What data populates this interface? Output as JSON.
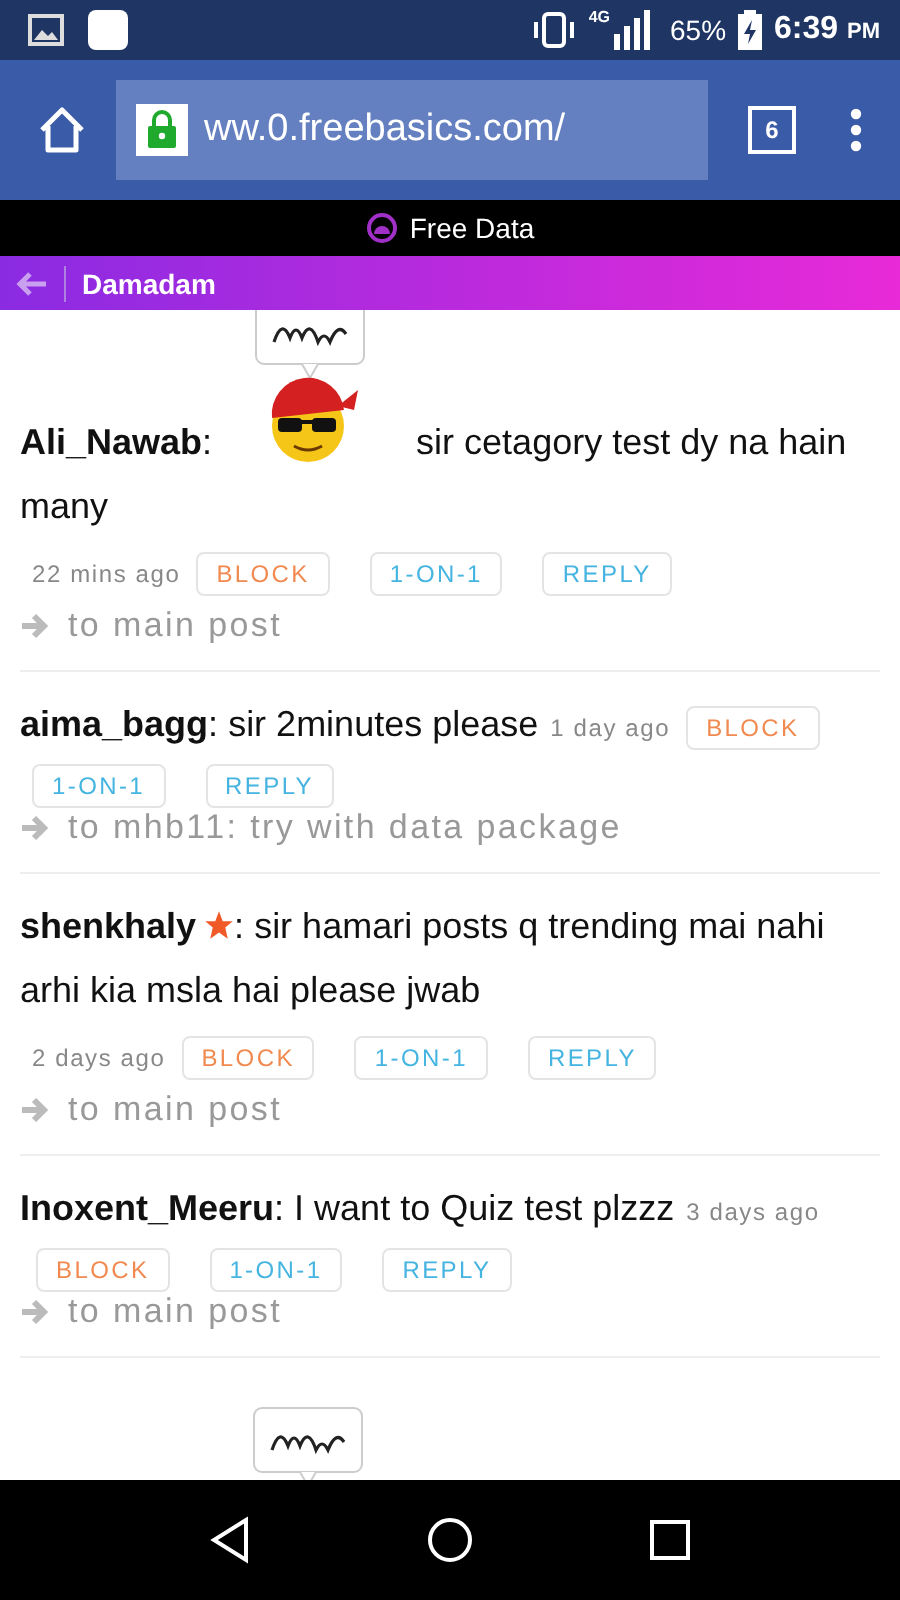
{
  "status_bar": {
    "network": "4G",
    "battery": "65%",
    "time": "6:39",
    "ampm": "PM"
  },
  "browser": {
    "url": "ww.0.freebasics.com/",
    "tabs_count": "6"
  },
  "free_data_bar": {
    "label": "Free Data"
  },
  "header": {
    "title": "Damadam"
  },
  "posts": [
    {
      "author": "Ali_Nawab",
      "separator": ":",
      "starred": false,
      "sticker": true,
      "message": "sir cetagory test dy na hain many",
      "time": "22 mins ago",
      "buttons": [
        "BLOCK",
        "1-ON-1",
        "REPLY"
      ],
      "link": "to main post"
    },
    {
      "author": "aima_bagg",
      "separator": ":",
      "starred": false,
      "sticker": false,
      "message": "sir 2minutes please",
      "time": "1 day ago",
      "buttons": [
        "BLOCK",
        "1-ON-1",
        "REPLY"
      ],
      "link": "to mhb11: try with data package"
    },
    {
      "author": "shenkhaly",
      "separator": ":",
      "starred": true,
      "sticker": false,
      "message": "sir hamari posts q trending mai nahi arhi kia msla hai please jwab",
      "time": "2 days ago",
      "buttons": [
        "BLOCK",
        "1-ON-1",
        "REPLY"
      ],
      "link": "to main post"
    },
    {
      "author": "Inoxent_Meeru",
      "separator": ":",
      "starred": false,
      "sticker": false,
      "message": "I want to Quiz test plzzz",
      "time": "3 days ago",
      "buttons": [
        "BLOCK",
        "1-ON-1",
        "REPLY"
      ],
      "link": "to main post"
    }
  ],
  "partial_post": {
    "sticker": true
  }
}
